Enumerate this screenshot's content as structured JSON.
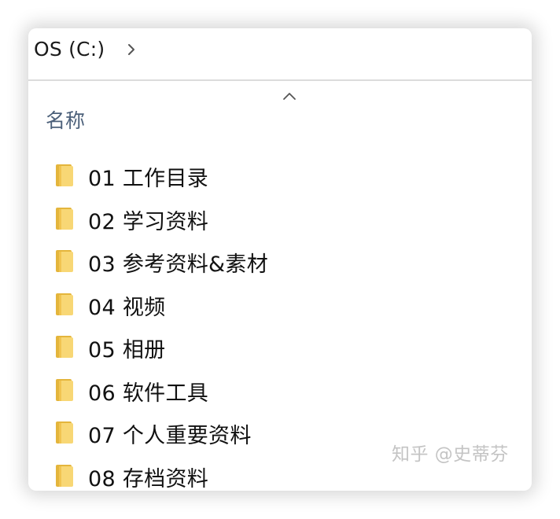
{
  "breadcrumb": {
    "drive_label": "OS (C:)"
  },
  "column_header": {
    "name_label": "名称"
  },
  "folders": [
    {
      "label": "01 工作目录"
    },
    {
      "label": "02 学习资料"
    },
    {
      "label": "03 参考资料&素材"
    },
    {
      "label": "04 视频"
    },
    {
      "label": "05 相册"
    },
    {
      "label": "06 软件工具"
    },
    {
      "label": "07 个人重要资料"
    },
    {
      "label": "08 存档资料"
    }
  ],
  "watermark": {
    "text": "知乎 @史蒂芬"
  },
  "icons": {
    "chevron": "chevron-right-icon",
    "sort": "sort-ascending-icon",
    "folder": "folder-icon"
  },
  "colors": {
    "folder_light": "#f8d775",
    "folder_dark": "#e4b53c",
    "header_text": "#4c607a"
  }
}
